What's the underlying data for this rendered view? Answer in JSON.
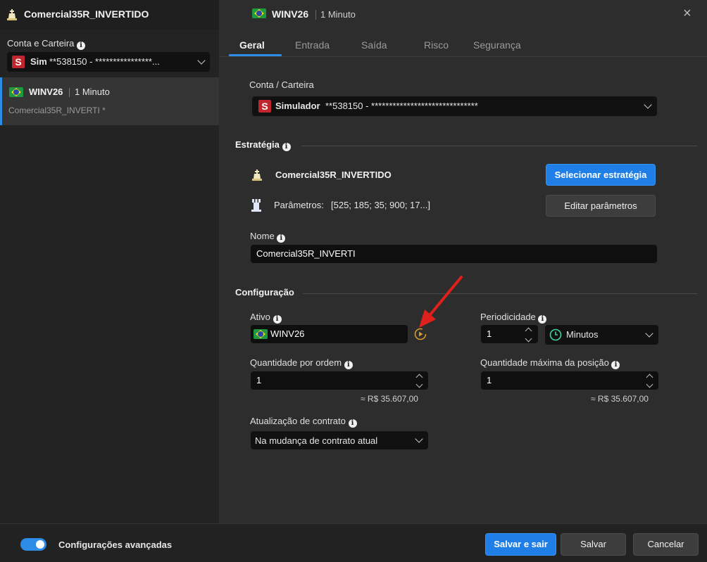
{
  "left": {
    "title": "Comercial35R_INVERTIDO",
    "conta_label": "Conta e Carteira",
    "account": {
      "badge": "S",
      "name": "Sim",
      "masked": "**538150 - ****************..."
    },
    "item": {
      "symbol": "WINV26",
      "period": "1 Minuto",
      "subtitle": "Comercial35R_INVERTI *"
    }
  },
  "header": {
    "symbol": "WINV26",
    "period": "1 Minuto",
    "close": "×"
  },
  "tabs": [
    {
      "label": "Geral",
      "active": true
    },
    {
      "label": "Entrada"
    },
    {
      "label": "Saída"
    },
    {
      "label": "Risco"
    },
    {
      "label": "Segurança"
    }
  ],
  "conta": {
    "label": "Conta / Carteira",
    "badge": "S",
    "name": "Simulador",
    "masked": "**538150 - ******************************"
  },
  "estrategia": {
    "title": "Estratégia",
    "name": "Comercial35R_INVERTIDO",
    "params_label": "Parâmetros:",
    "params_value": "[525; 185; 35; 900; 17...]",
    "select_button": "Selecionar estratégia",
    "edit_button": "Editar parâmetros",
    "nome_label": "Nome",
    "nome_value": "Comercial35R_INVERTI"
  },
  "config": {
    "title": "Configuração",
    "ativo_label": "Ativo",
    "ativo_value": "WINV26",
    "periodicidade_label": "Periodicidade",
    "periodicidade_value": "1",
    "periodicidade_unit": "Minutos",
    "qtd_ordem_label": "Quantidade por ordem",
    "qtd_ordem_value": "1",
    "qtd_ordem_approx": "≈ R$ 35.607,00",
    "qtd_max_label": "Quantidade máxima da posição",
    "qtd_max_value": "1",
    "qtd_max_approx": "≈ R$ 35.607,00",
    "atualizacao_label": "Atualização de contrato",
    "atualizacao_value": "Na mudança de contrato atual"
  },
  "footer": {
    "advanced_label": "Configurações avançadas",
    "advanced_on": true,
    "save_exit": "Salvar e sair",
    "save": "Salvar",
    "cancel": "Cancelar"
  },
  "colors": {
    "accent": "#2d8ce6",
    "primary_button": "#1f7fe6",
    "badge_red": "#c0262d",
    "arrow_red": "#e0201c"
  },
  "icons": {
    "strategy": "chess-king-icon",
    "params": "chess-rook-icon",
    "info": "info-icon",
    "replay": "replay-icon",
    "clock": "clock-icon",
    "flag": "brazil-flag-icon"
  }
}
